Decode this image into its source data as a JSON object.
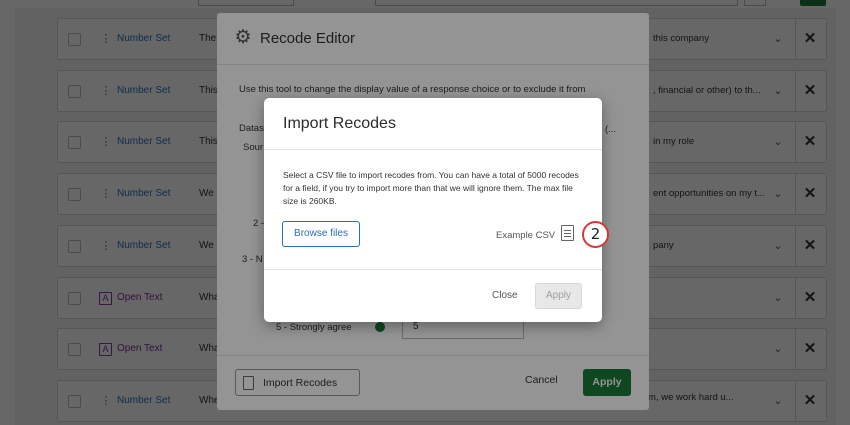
{
  "background": {
    "rows": [
      {
        "type": "Number Set",
        "kind": "number",
        "question_start": "Ther",
        "question_end": "this company"
      },
      {
        "type": "Number Set",
        "kind": "number",
        "question_start": "This",
        "question_end": ", financial or other) to th..."
      },
      {
        "type": "Number Set",
        "kind": "number",
        "question_start": "This",
        "question_end": "in my role"
      },
      {
        "type": "Number Set",
        "kind": "number",
        "question_start": "We a",
        "question_end": "ent opportunities on my t..."
      },
      {
        "type": "Number Set",
        "kind": "number",
        "question_start": "We a",
        "question_end": "pany"
      },
      {
        "type": "Open Text",
        "kind": "text",
        "question_start": "Wha",
        "question_end": ""
      },
      {
        "type": "Open Text",
        "kind": "text",
        "question_start": "Wha",
        "question_end": ""
      },
      {
        "type": "Number Set",
        "kind": "number",
        "question_start": "When there is a problem",
        "question_mid": "Q3_2 - When there is a problem with a product/service on my team, we work hard u...",
        "question_end": ""
      }
    ],
    "text_icon_glyph": "A",
    "number_icon_glyph": "⋮",
    "chevron_glyph": "⌄",
    "remove_glyph": "✕"
  },
  "editor": {
    "title": "Recode Editor",
    "icon": "gear-icon",
    "description": "Use this tool to change the display value of a response choice or to exclude it from",
    "dataset_label": "Datas",
    "source_label": "Sour",
    "truncated_paren": "(...",
    "row2_label": "2 -",
    "row3_label": "3 - N",
    "row5_label": "5 - Strongly agree",
    "row5_value": "5",
    "import_button": "Import Recodes",
    "cancel_button": "Cancel",
    "apply_button": "Apply"
  },
  "modal": {
    "title": "Import Recodes",
    "body": "Select a CSV file to import recodes from. You can have a total of 5000 recodes for a field, if you try to import more than that we will ignore them. The max file size is 260KB.",
    "browse_button": "Browse files",
    "example_link": "Example CSV",
    "close_button": "Close",
    "apply_button": "Apply"
  },
  "step_badge": "2",
  "colors": {
    "accent_blue": "#2a6ebb",
    "apply_green": "#1a7a3a",
    "badge_red": "#d23a3a",
    "open_text_purple": "#7b2e98"
  }
}
